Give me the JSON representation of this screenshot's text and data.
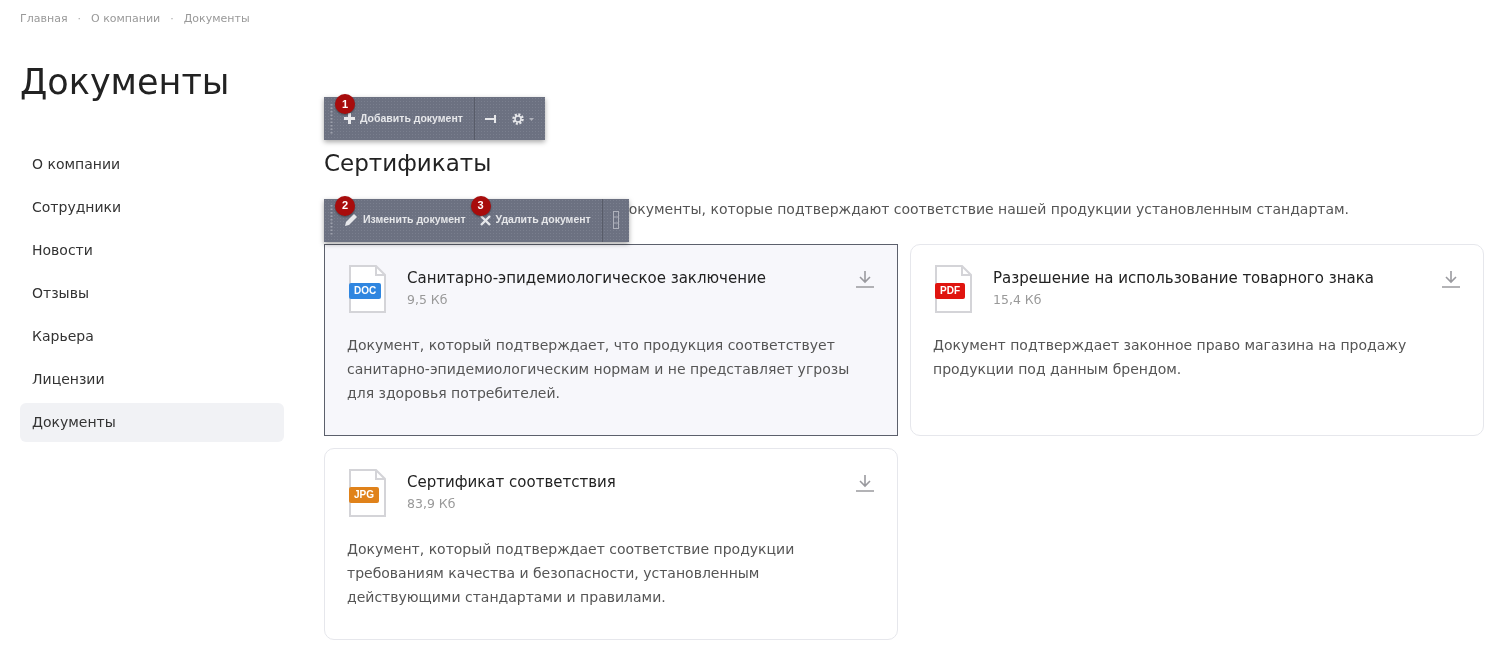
{
  "breadcrumbs": [
    {
      "label": "Главная",
      "separator": "·"
    },
    {
      "label": "О компании",
      "separator": "·"
    },
    {
      "label": "Документы"
    }
  ],
  "page_title": "Документы",
  "sidebar": {
    "items": [
      {
        "label": "О компании",
        "selected": false
      },
      {
        "label": "Сотрудники",
        "selected": false
      },
      {
        "label": "Новости",
        "selected": false
      },
      {
        "label": "Отзывы",
        "selected": false
      },
      {
        "label": "Карьера",
        "selected": false
      },
      {
        "label": "Лицензии",
        "selected": false
      },
      {
        "label": "Документы",
        "selected": true
      }
    ]
  },
  "toolbars": [
    {
      "items": [
        {
          "kind": "add",
          "label": "Добавить документ",
          "badge": "1"
        },
        {
          "kind": "pin"
        },
        {
          "kind": "settings"
        }
      ]
    },
    {
      "items": [
        {
          "kind": "edit",
          "label": "Изменить документ",
          "badge": "2"
        },
        {
          "kind": "delete",
          "label": "Удалить документ",
          "badge": "3"
        },
        {
          "kind": "handle"
        }
      ]
    }
  ],
  "section": {
    "title": "Сертификаты",
    "description": "окументы, которые подтверждают соответствие нашей продукции установленным стандартам.",
    "documents": [
      {
        "title": "Санитарно-эпидемиологическое заключение",
        "size": "9,5 Кб",
        "file_type": "DOC",
        "color": "#2f86e0",
        "highlighted": true,
        "description": "Документ, который подтверждает, что продукция соответствует санитарно-эпидемиологическим нормам и не представляет угрозы для здоровья потребителей."
      },
      {
        "title": "Разрешение на использование товарного знака",
        "size": "15,4 Кб",
        "file_type": "PDF",
        "color": "#e0140f",
        "highlighted": false,
        "description": "Документ подтверждает законное право магазина на продажу продукции под данным брендом."
      },
      {
        "title": "Сертификат соответствия",
        "size": "83,9 Кб",
        "file_type": "JPG",
        "color": "#e0821a",
        "highlighted": false,
        "description": "Документ, который подтверждает соответствие продукции требованиям качества и безопасности, установленным действующими стандартами и правилами."
      }
    ]
  }
}
